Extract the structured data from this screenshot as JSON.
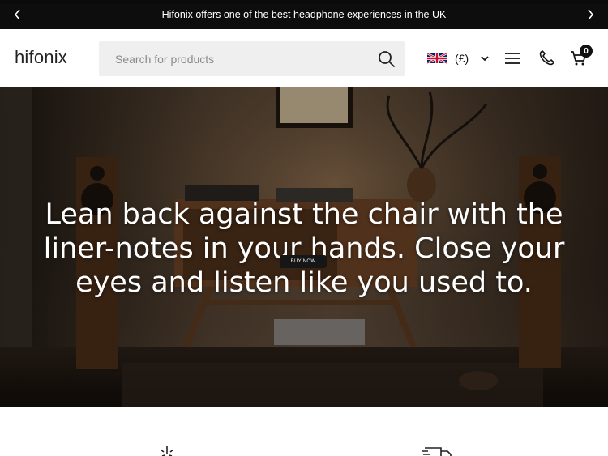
{
  "announcement": {
    "text": "Hifonix offers one of the best headphone experiences in the UK",
    "prev_icon": "chevron-left-icon",
    "next_icon": "chevron-right-icon"
  },
  "header": {
    "logo": "hifonix",
    "search": {
      "placeholder": "Search for products",
      "value": "",
      "icon": "search-icon"
    },
    "locale": {
      "flag": "uk-flag-icon",
      "currency": "(£)"
    },
    "menu_icon": "hamburger-menu-icon",
    "phone_icon": "phone-icon",
    "cart": {
      "icon": "cart-icon",
      "count": "0"
    }
  },
  "hero": {
    "headline": "Lean back against the chair with the liner-notes in your hands. Close your eyes and listen like you used to.",
    "button": "BUY NOW"
  },
  "colors": {
    "announcement_bg": "#0d0d0d",
    "search_bg": "#efefef",
    "accent": "#111111"
  }
}
